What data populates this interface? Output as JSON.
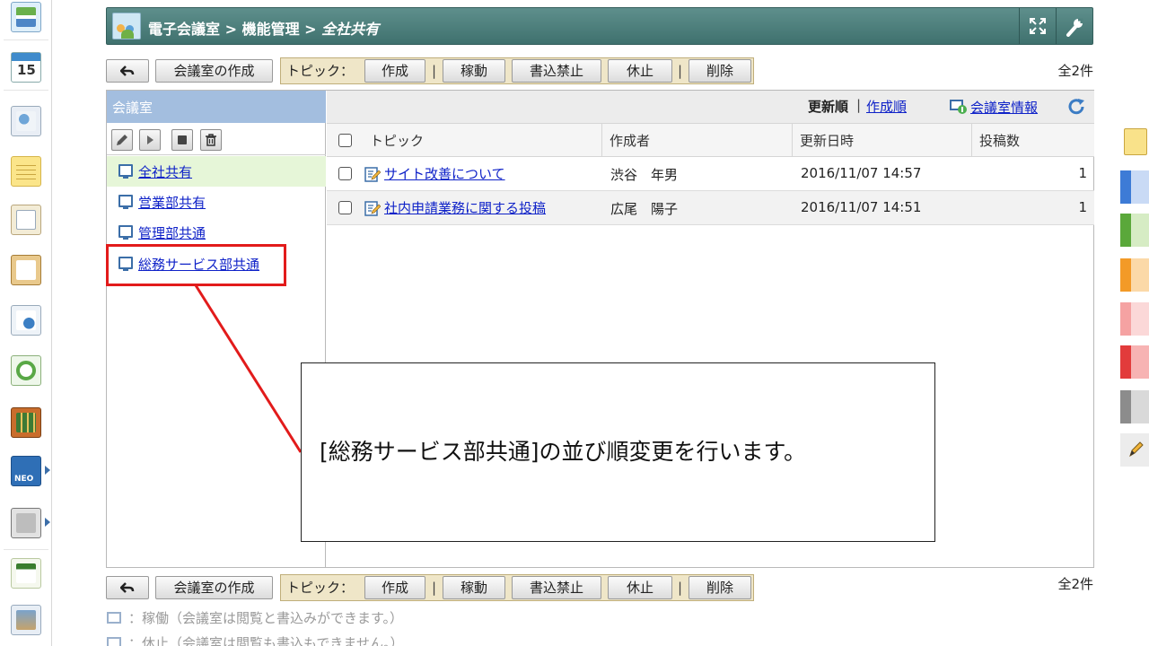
{
  "header": {
    "app_name": "電子会議室",
    "sep1": " > ",
    "section": "機能管理",
    "sep2": " > ",
    "current": "全社共有"
  },
  "toolbar": {
    "back_label": "",
    "create_room": "会議室の作成",
    "topic_group_label": "トピック：",
    "create": "作成",
    "activate": "稼動",
    "write_prohibit": "書込禁止",
    "suspend": "休止",
    "delete": "削除",
    "group_sep": "|",
    "count": "全2件"
  },
  "left_panel": {
    "title": "会議室",
    "rooms": [
      {
        "label": "全社共有",
        "selected": true
      },
      {
        "label": "営業部共有",
        "selected": false
      },
      {
        "label": "管理部共通",
        "selected": false
      },
      {
        "label": "総務サービス部共通",
        "selected": false
      }
    ]
  },
  "sort_bar": {
    "updated_order": "更新順",
    "separator": "|",
    "created_order": "作成順",
    "room_info": "会議室情報"
  },
  "table": {
    "columns": [
      "トピック",
      "作成者",
      "更新日時",
      "投稿数"
    ],
    "rows": [
      {
        "topic": "サイト改善について",
        "author": "渋谷　年男",
        "updated": "2016/11/07 14:57",
        "posts": "1"
      },
      {
        "topic": "社内申請業務に関する投稿",
        "author": "広尾　陽子",
        "updated": "2016/11/07 14:51",
        "posts": "1"
      }
    ]
  },
  "callout": {
    "text": "[総務サービス部共通]の並び順変更を行います。"
  },
  "legend": {
    "active": "：稼働（会議室は閲覧と書込みができます。）",
    "suspended": "：休止（会議室は閲覧も書込もできません。）"
  },
  "colors": {
    "header_bg": "#4f817e",
    "room_header_bg": "#a3bedf",
    "selected_room_bg": "#e6f6d8",
    "link": "#0f22c8",
    "highlight": "#e21b1b"
  }
}
